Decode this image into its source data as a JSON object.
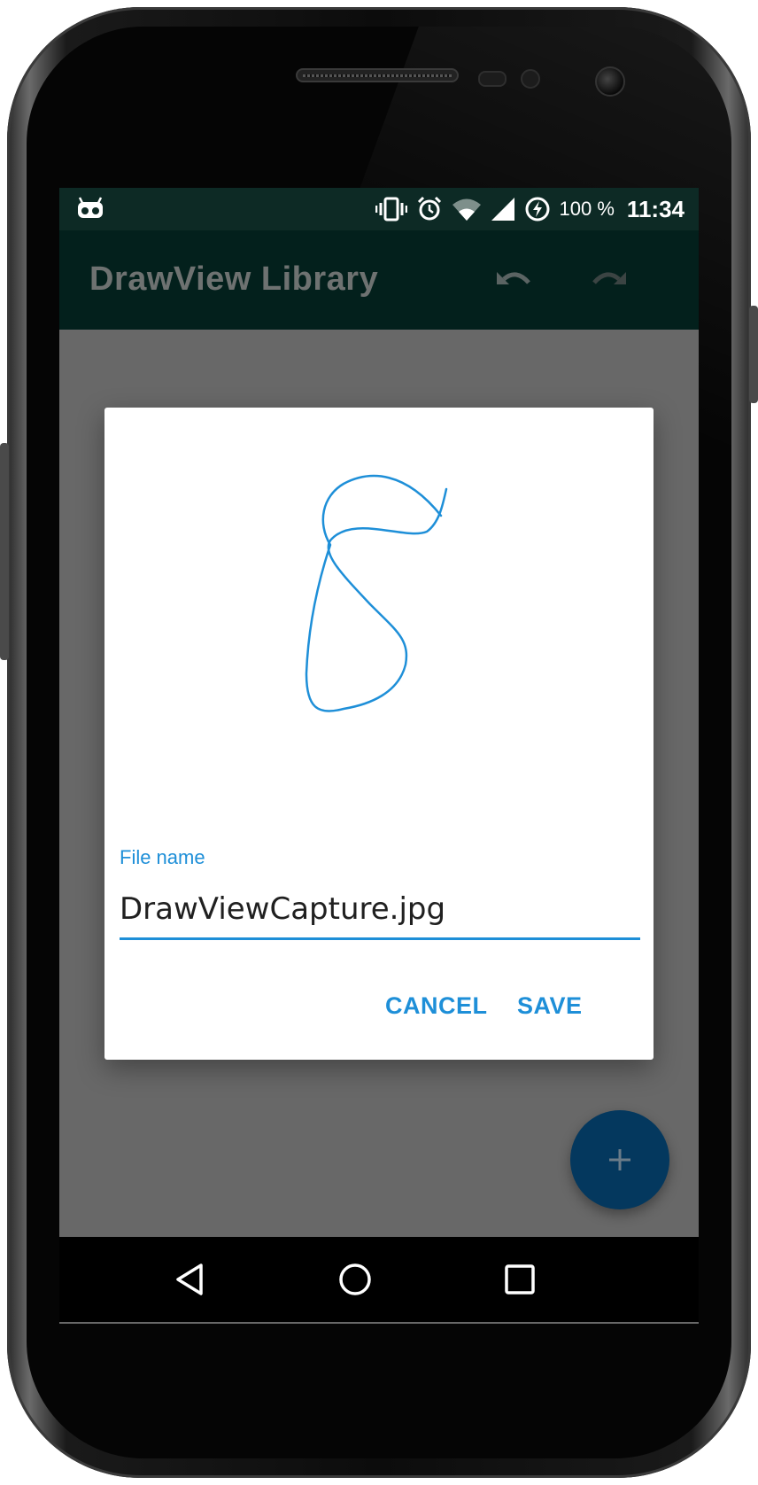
{
  "status_bar": {
    "battery_percent": "100 %",
    "time": "11:34",
    "icons": [
      "android-debug-icon",
      "vibrate-icon",
      "alarm-icon",
      "wifi-icon",
      "signal-icon",
      "battery-charging-icon"
    ]
  },
  "app_bar": {
    "title": "DrawView Library",
    "actions": [
      "undo-icon",
      "redo-icon"
    ]
  },
  "dialog": {
    "field_label": "File name",
    "field_value": "DrawViewCapture.jpg",
    "cancel_label": "CANCEL",
    "save_label": "SAVE"
  },
  "fab": {
    "icon": "plus-icon"
  },
  "nav_bar": {
    "icons": [
      "back-icon",
      "home-icon",
      "recents-icon"
    ]
  },
  "colors": {
    "accent": "#1e8fd8",
    "primary_dark": "#03201c",
    "status_bar": "#0d2a25",
    "fab": "#04385e",
    "scrim": "#686868"
  }
}
